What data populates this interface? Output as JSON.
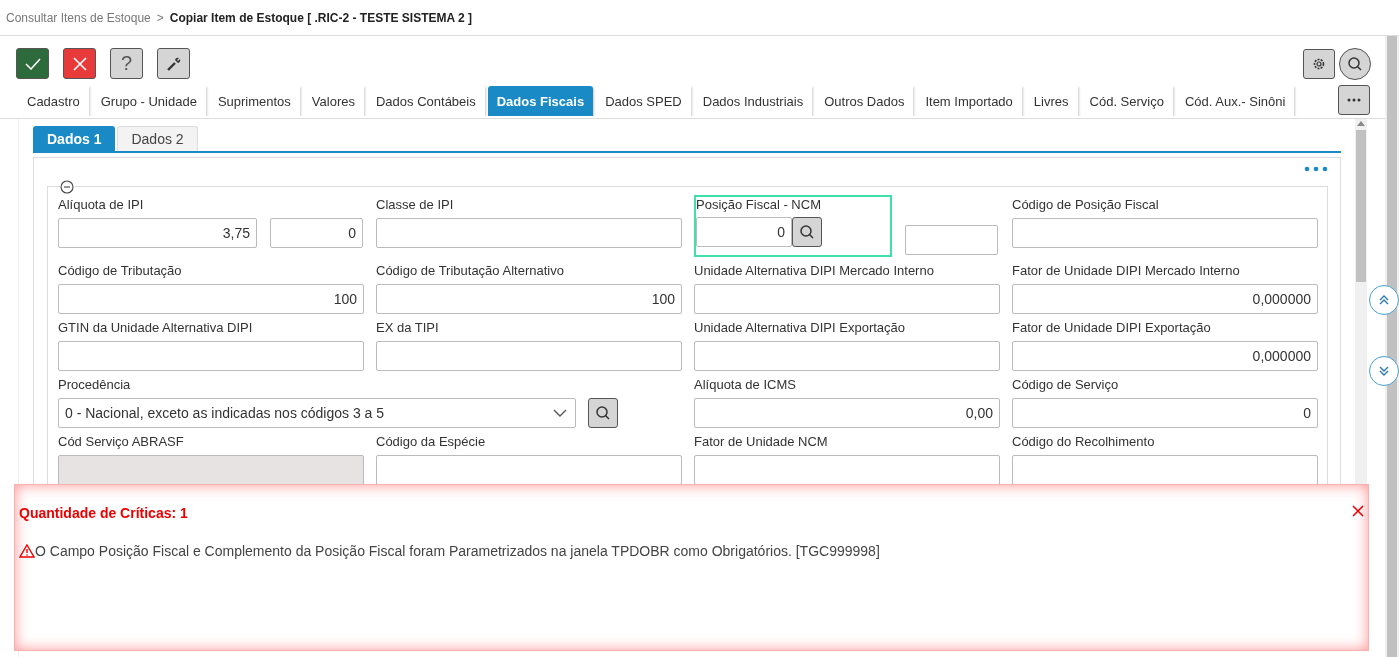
{
  "breadcrumb": {
    "parent": "Consultar Itens de Estoque",
    "separator": ">",
    "current": "Copiar Item de Estoque [ .RIC-2 - TESTE SISTEMA 2 ]"
  },
  "toolbar": [
    {
      "kind": "confirm"
    },
    {
      "kind": "cancel"
    },
    {
      "kind": "help",
      "label": "?"
    },
    {
      "kind": "tools"
    }
  ],
  "tabs": [
    {
      "label": "Cadastro",
      "selected": false
    },
    {
      "label": "Grupo - Unidade",
      "selected": false
    },
    {
      "label": "Suprimentos",
      "selected": false
    },
    {
      "label": "Valores",
      "selected": false
    },
    {
      "label": "Dados Contábeis",
      "selected": false
    },
    {
      "label": "Dados Fiscais",
      "selected": true
    },
    {
      "label": "Dados SPED",
      "selected": false
    },
    {
      "label": "Dados Industriais",
      "selected": false
    },
    {
      "label": "Outros Dados",
      "selected": false
    },
    {
      "label": "Item Importado",
      "selected": false
    },
    {
      "label": "Livres",
      "selected": false
    },
    {
      "label": "Cód. Serviço",
      "selected": false
    },
    {
      "label": "Cód. Aux.- Sinôni",
      "selected": false
    }
  ],
  "subtabs": [
    {
      "label": "Dados 1",
      "selected": true
    },
    {
      "label": "Dados 2",
      "selected": false
    }
  ],
  "fields": [
    {
      "kind": "pair",
      "label": "Alíquota de IPI",
      "value": "3,75",
      "value_2": "0"
    },
    {
      "kind": "text",
      "label": "Classe de IPI"
    },
    {
      "kind": "lookup",
      "label": "Posição Fiscal - NCM",
      "value": "0",
      "focused": true
    },
    {
      "kind": "text",
      "label": "Código de Posição Fiscal"
    },
    {
      "kind": "text",
      "label": "Código de Tributação",
      "value": "100"
    },
    {
      "kind": "text",
      "label": "Código de Tributação Alternativo",
      "value": "100"
    },
    {
      "kind": "text",
      "label": "Unidade Alternativa DIPI Mercado Interno"
    },
    {
      "kind": "text",
      "label": "Fator de Unidade DIPI Mercado Interno",
      "value": "0,000000"
    },
    {
      "kind": "text",
      "label": "GTIN da Unidade Alternativa DIPI"
    },
    {
      "kind": "text",
      "label": "EX da TIPI"
    },
    {
      "kind": "text",
      "label": "Unidade Alternativa DIPI Exportação"
    },
    {
      "kind": "text",
      "label": "Fator de Unidade DIPI Exportação",
      "value": "0,000000"
    },
    {
      "kind": "select",
      "label": "Procedência",
      "value": "0 - Nacional, exceto as indicadas nos códigos 3 a 5"
    },
    {
      "kind": "text",
      "label": "Alíquota de ICMS",
      "value": "0,00"
    },
    {
      "kind": "text",
      "label": "Código de Serviço",
      "value": "0"
    },
    {
      "kind": "text",
      "label": "Cód Serviço ABRASF",
      "disabled": true
    },
    {
      "kind": "text",
      "label": "Código da Espécie"
    },
    {
      "kind": "text",
      "label": "Fator de Unidade NCM"
    },
    {
      "kind": "text",
      "label": "Código do Recolhimento"
    }
  ],
  "errors": {
    "title": "Quantidade de Críticas: 1",
    "messages": [
      "O Campo Posição Fiscal e Complemento da Posição Fiscal foram Parametrizados na janela TPDOBR como Obrigatórios. [TGC999998]"
    ]
  }
}
